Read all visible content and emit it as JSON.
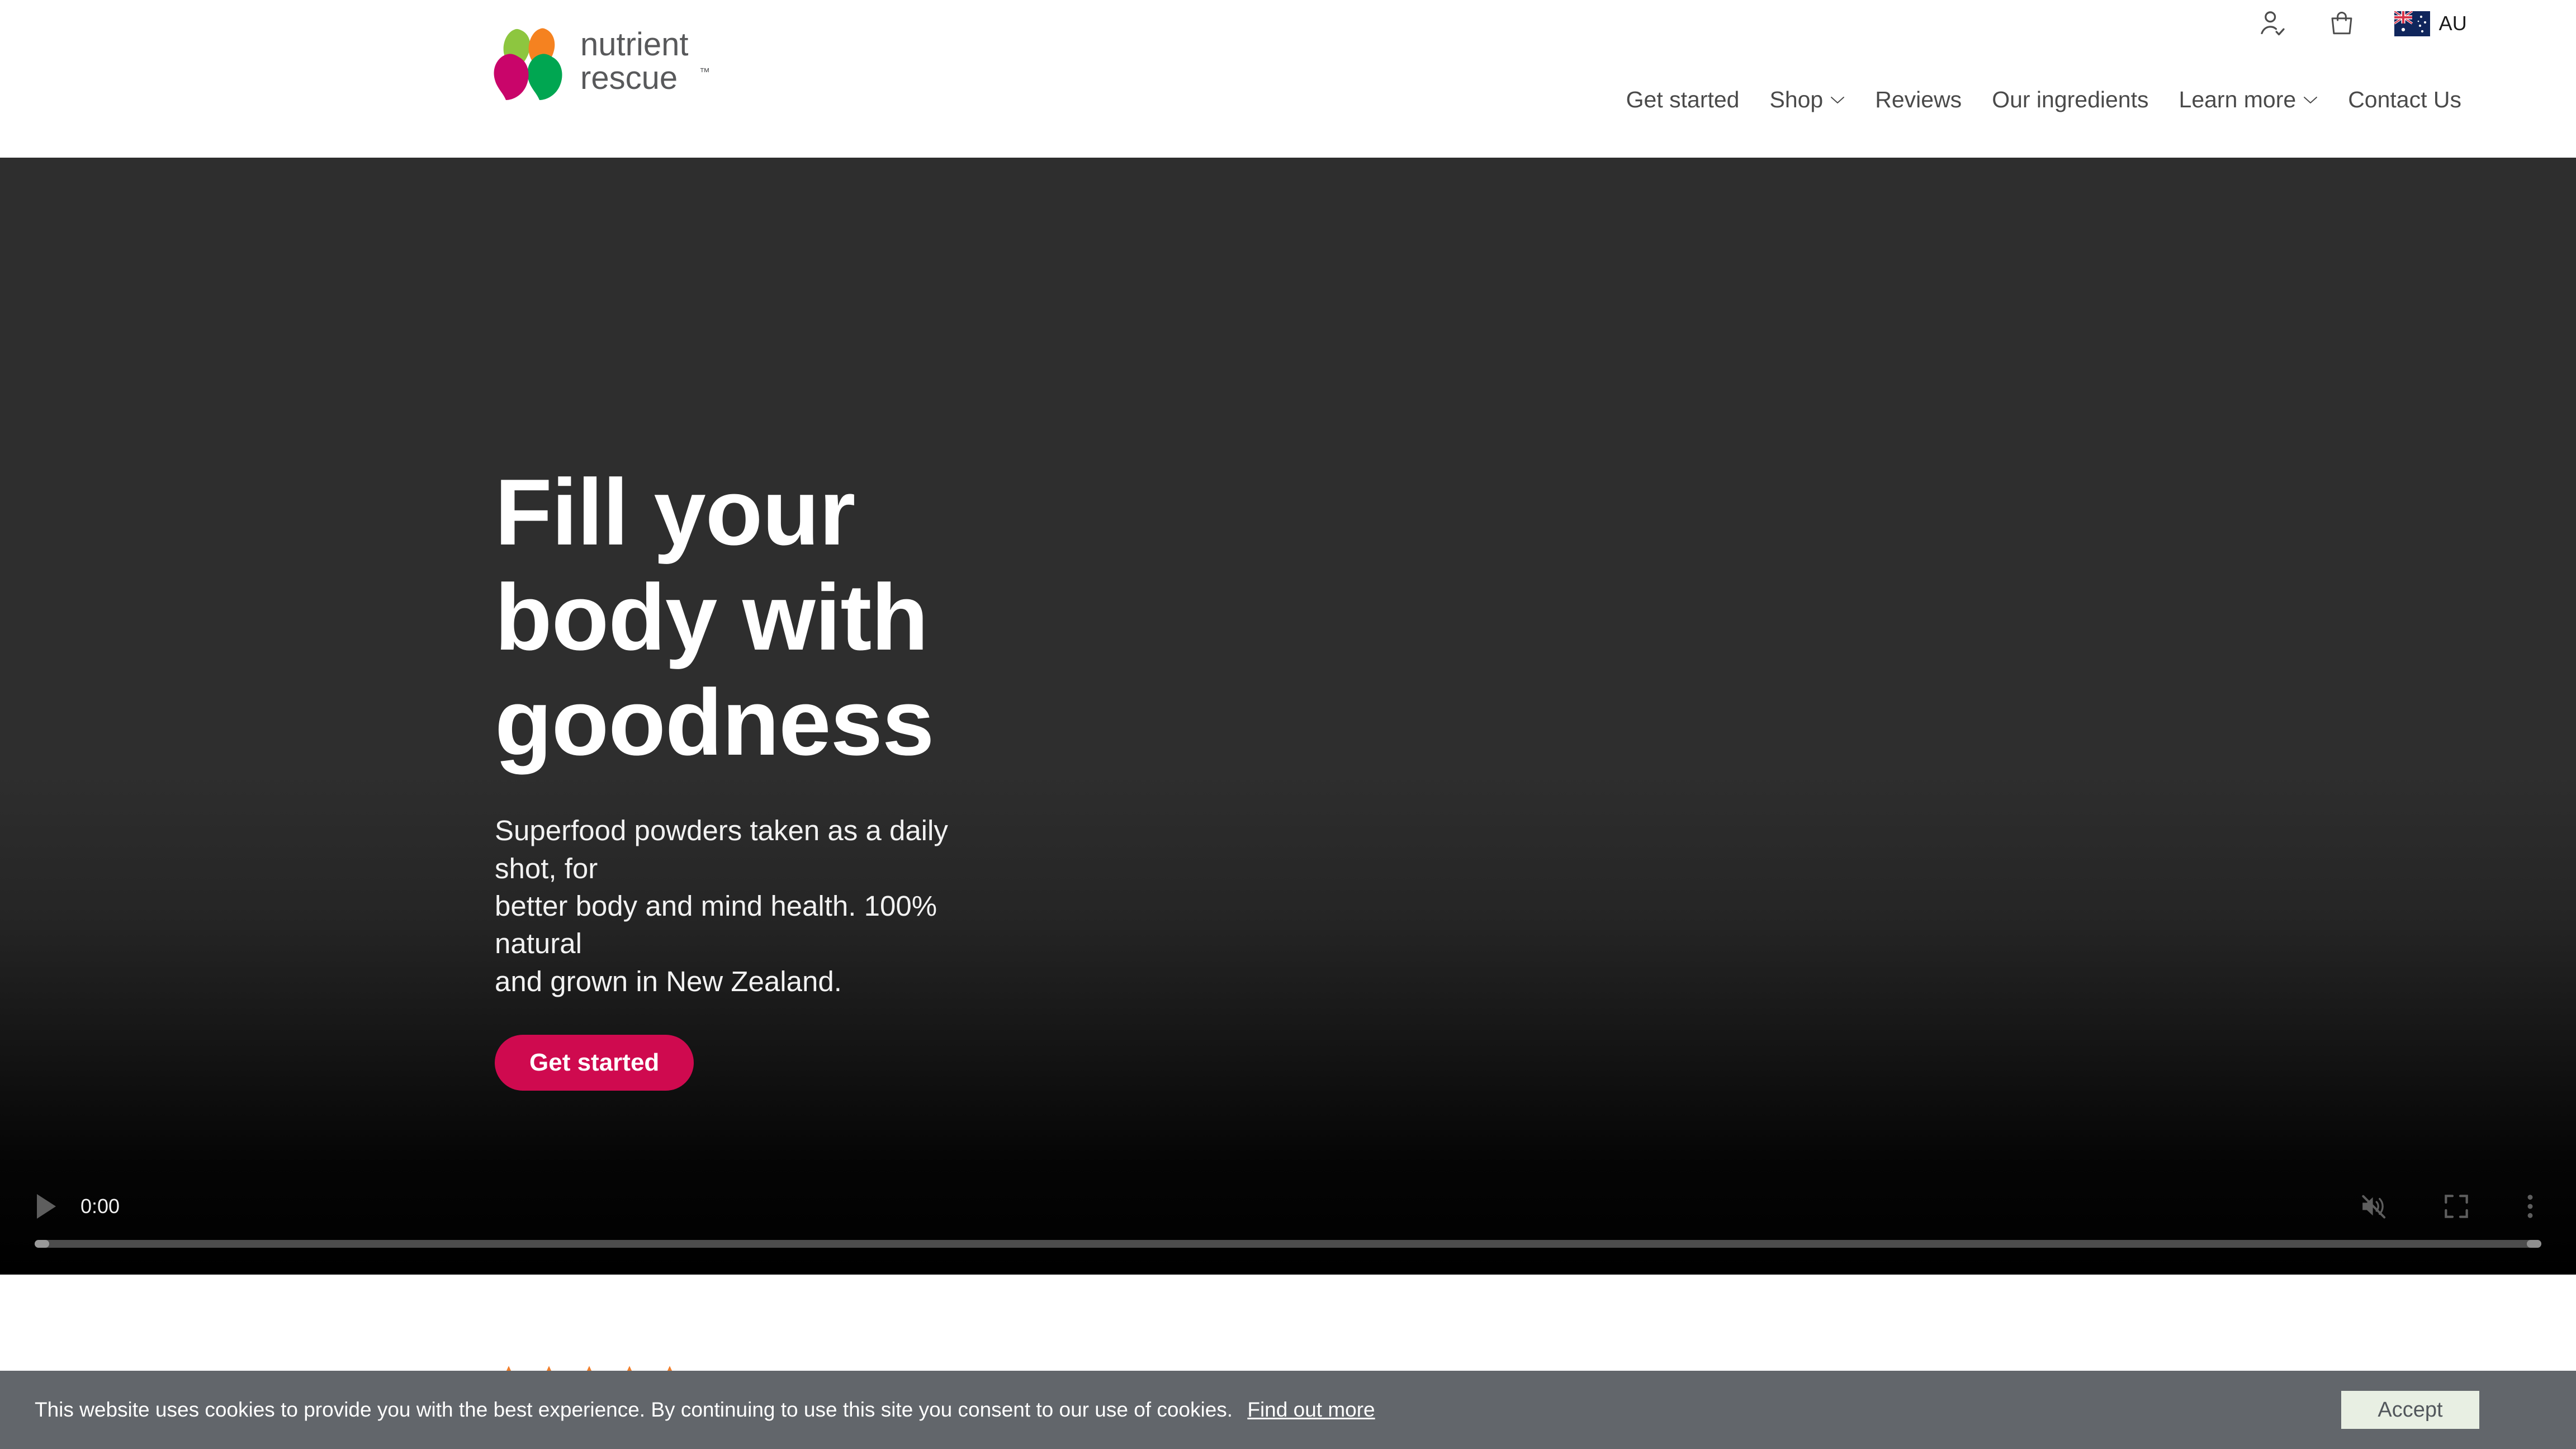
{
  "brand": {
    "name": "nutrient rescue",
    "word_top": "nutrient",
    "word_bottom": "rescue",
    "trademark": "TM",
    "colors": {
      "petal_light_green": "#8DC63F",
      "petal_orange": "#F58220",
      "petal_dark_green": "#00A651",
      "petal_magenta": "#C9056A",
      "wordmark_grey": "#58595B"
    }
  },
  "header": {
    "utility": {
      "account_icon": "user-check-icon",
      "cart_icon": "shopping-bag-icon",
      "region_flag": "australia-flag-icon",
      "region_label": "AU"
    },
    "nav": [
      {
        "label": "Get started",
        "has_dropdown": false
      },
      {
        "label": "Shop",
        "has_dropdown": true
      },
      {
        "label": "Reviews",
        "has_dropdown": false
      },
      {
        "label": "Our ingredients",
        "has_dropdown": false
      },
      {
        "label": "Learn more",
        "has_dropdown": true
      },
      {
        "label": "Contact Us",
        "has_dropdown": false
      }
    ]
  },
  "hero": {
    "title_line1": "Fill your",
    "title_line2": "body with",
    "title_line3": "goodness",
    "subtitle_line1": "Superfood powders taken as a daily shot, for",
    "subtitle_line2": "better body and mind health. 100% natural",
    "subtitle_line3": "and grown in New Zealand.",
    "cta_label": "Get started",
    "cta_color": "#cf0a4f",
    "background_color": "#2e2e2e"
  },
  "video": {
    "play_icon": "play-icon",
    "current_time": "0:00",
    "mute_icon": "volume-muted-icon",
    "fullscreen_icon": "fullscreen-icon",
    "overflow_icon": "more-options-icon",
    "progress_percent": 0
  },
  "reviews": {
    "star_icon": "star-icon",
    "star_count": 5,
    "star_color": "#F07F2D"
  },
  "cookie_banner": {
    "message": "This website uses cookies to provide you with the best experience. By continuing to use this site you consent to our use of cookies.",
    "link_label": "Find out more",
    "accept_label": "Accept",
    "background_color": "#62666b",
    "accept_background": "#e8efe3"
  }
}
